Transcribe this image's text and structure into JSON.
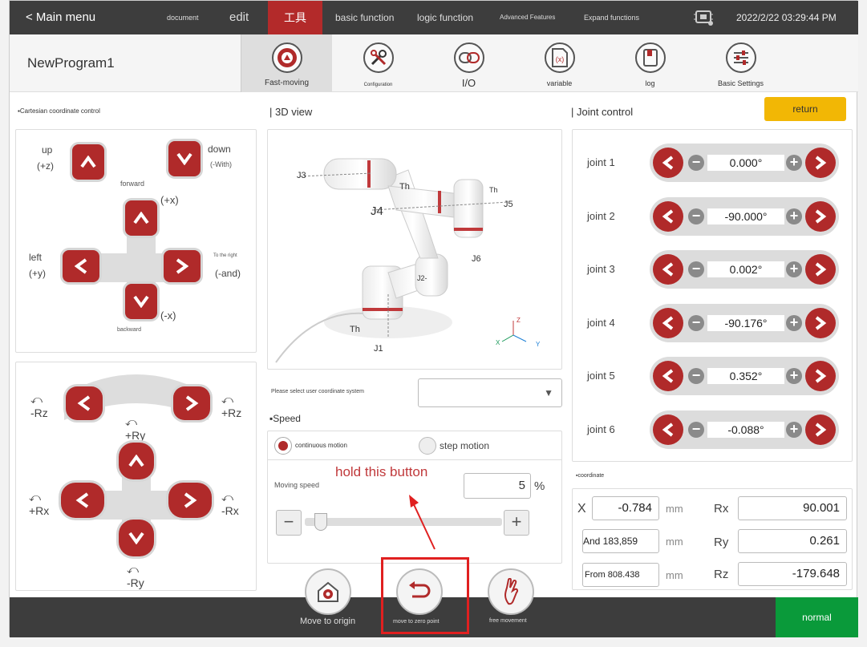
{
  "topbar": {
    "main_menu": "< Main menu",
    "tabs": [
      {
        "label": "document"
      },
      {
        "label": "edit"
      },
      {
        "label": "工具"
      },
      {
        "label": "basic function"
      },
      {
        "label": "logic function"
      },
      {
        "label": "Advanced Features"
      },
      {
        "label": "Expand functions"
      }
    ],
    "datetime": "2022/2/22 03:29:44 PM"
  },
  "program": {
    "name": "NewProgram1",
    "tools": [
      {
        "label": "Fast-moving",
        "icon": "target-icon"
      },
      {
        "label": "Configuration",
        "icon": "wrench-screwdriver-icon"
      },
      {
        "label": "I/O",
        "icon": "io-icon"
      },
      {
        "label": "variable",
        "icon": "variable-icon"
      },
      {
        "label": "log",
        "icon": "log-icon"
      },
      {
        "label": "Basic Settings",
        "icon": "sliders-icon"
      }
    ]
  },
  "cartesian": {
    "title": "Cartesian coordinate control",
    "up": "up",
    "up_axis": "(+z)",
    "down": "down",
    "down_axis": "(-With)",
    "forward": "forward",
    "forward_axis": "(+x)",
    "backward": "backward",
    "backward_axis": "(-x)",
    "left": "left",
    "left_axis": "(+y)",
    "right": "To the right",
    "right_axis": "(-and)"
  },
  "rotation": {
    "minus_rz": "-Rz",
    "plus_rz": "+Rz",
    "plus_ry": "+Ry",
    "plus_rx": "+Rx",
    "minus_rx": "-Rx",
    "minus_ry": "-Ry"
  },
  "view3d": {
    "title": "| 3D view",
    "labels": {
      "j1": "J1",
      "j2": "J2-",
      "j3": "J3",
      "j4": "J4",
      "j5": "J5",
      "j6": "J6",
      "th": "Th"
    },
    "axes": {
      "x": "X",
      "y": "Y",
      "z": "Z"
    }
  },
  "ucs": {
    "label": "Please select user coordinate system",
    "value": ""
  },
  "speed": {
    "title": "Speed",
    "continuous": "continuous motion",
    "step": "step motion",
    "moving_speed_label": "Moving speed",
    "value": "5",
    "unit": "%",
    "slider_fraction": 0.05
  },
  "annotation": {
    "hold_text": "hold this button"
  },
  "joints": {
    "title": "| Joint control",
    "return": "return",
    "rows": [
      {
        "label": "joint 1",
        "value": "0.000°"
      },
      {
        "label": "joint 2",
        "value": "-90.000°"
      },
      {
        "label": "joint 3",
        "value": "0.002°"
      },
      {
        "label": "joint 4",
        "value": "-90.176°"
      },
      {
        "label": "joint 5",
        "value": "0.352°"
      },
      {
        "label": "joint 6",
        "value": "-0.088°"
      }
    ]
  },
  "coordinate": {
    "title": "coordinate",
    "x_label": "X",
    "x_value": "-0.784",
    "y_text": "And 183,859",
    "z_text": "From 808.438",
    "unit": "mm",
    "rx_label": "Rx",
    "rx_value": "90.001",
    "ry_label": "Ry",
    "ry_value": "0.261",
    "rz_label": "Rz",
    "rz_value": "-179.648"
  },
  "bottom": {
    "move_origin": "Move to origin",
    "move_zero": "move to zero point",
    "free_move": "free movement",
    "status": "normal"
  },
  "colors": {
    "accent": "#b02a2a",
    "status_ok": "#0a9a3a",
    "return_btn": "#f2b705"
  }
}
